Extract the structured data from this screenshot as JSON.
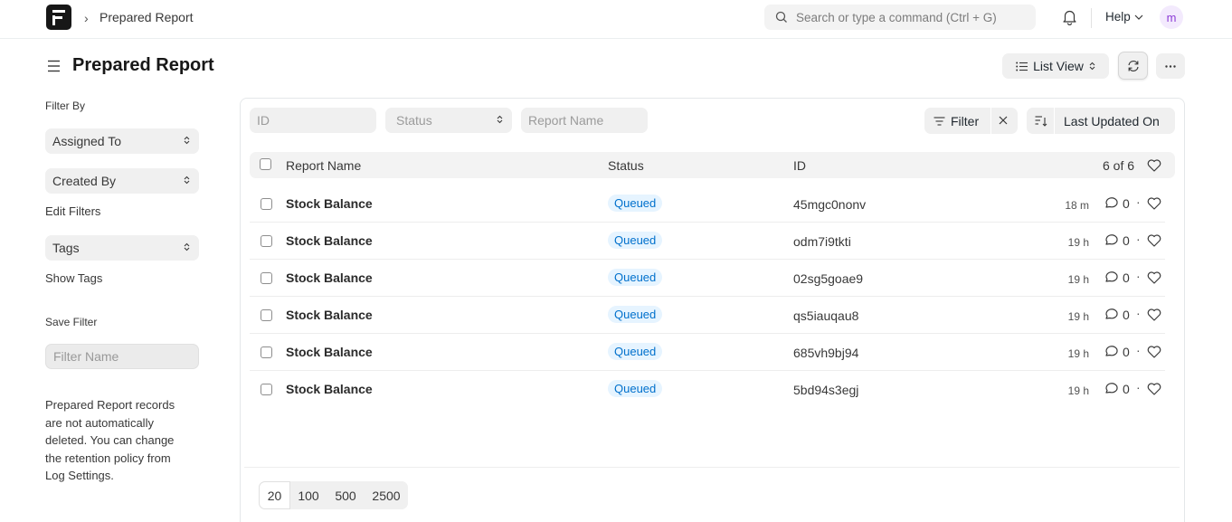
{
  "navbar": {
    "breadcrumb": "Prepared Report",
    "search_placeholder": "Search or type a command (Ctrl + G)",
    "help_label": "Help",
    "avatar_initial": "m"
  },
  "page": {
    "title": "Prepared Report",
    "view_label": "List View"
  },
  "sidebar": {
    "filter_by": "Filter By",
    "assigned_to": "Assigned To",
    "created_by": "Created By",
    "edit_filters": "Edit Filters",
    "tags": "Tags",
    "show_tags": "Show Tags",
    "save_filter": "Save Filter",
    "filter_name_placeholder": "Filter Name",
    "note": "Prepared Report records are not automatically deleted. You can change the retention policy from Log Settings."
  },
  "filters": {
    "id_placeholder": "ID",
    "status_placeholder": "Status",
    "report_name_placeholder": "Report Name",
    "filter_label": "Filter",
    "sort_label": "Last Updated On"
  },
  "table": {
    "col_report_name": "Report Name",
    "col_status": "Status",
    "col_id": "ID",
    "count": "6 of 6",
    "rows": [
      {
        "name": "Stock Balance",
        "status": "Queued",
        "id": "45mgc0nonv",
        "time": "18 m",
        "comments": "0"
      },
      {
        "name": "Stock Balance",
        "status": "Queued",
        "id": "odm7i9tkti",
        "time": "19 h",
        "comments": "0"
      },
      {
        "name": "Stock Balance",
        "status": "Queued",
        "id": "02sg5goae9",
        "time": "19 h",
        "comments": "0"
      },
      {
        "name": "Stock Balance",
        "status": "Queued",
        "id": "qs5iauqau8",
        "time": "19 h",
        "comments": "0"
      },
      {
        "name": "Stock Balance",
        "status": "Queued",
        "id": "685vh9bj94",
        "time": "19 h",
        "comments": "0"
      },
      {
        "name": "Stock Balance",
        "status": "Queued",
        "id": "5bd94s3egj",
        "time": "19 h",
        "comments": "0"
      }
    ]
  },
  "paging": {
    "options": [
      "20",
      "100",
      "500",
      "2500"
    ],
    "selected": "20"
  }
}
